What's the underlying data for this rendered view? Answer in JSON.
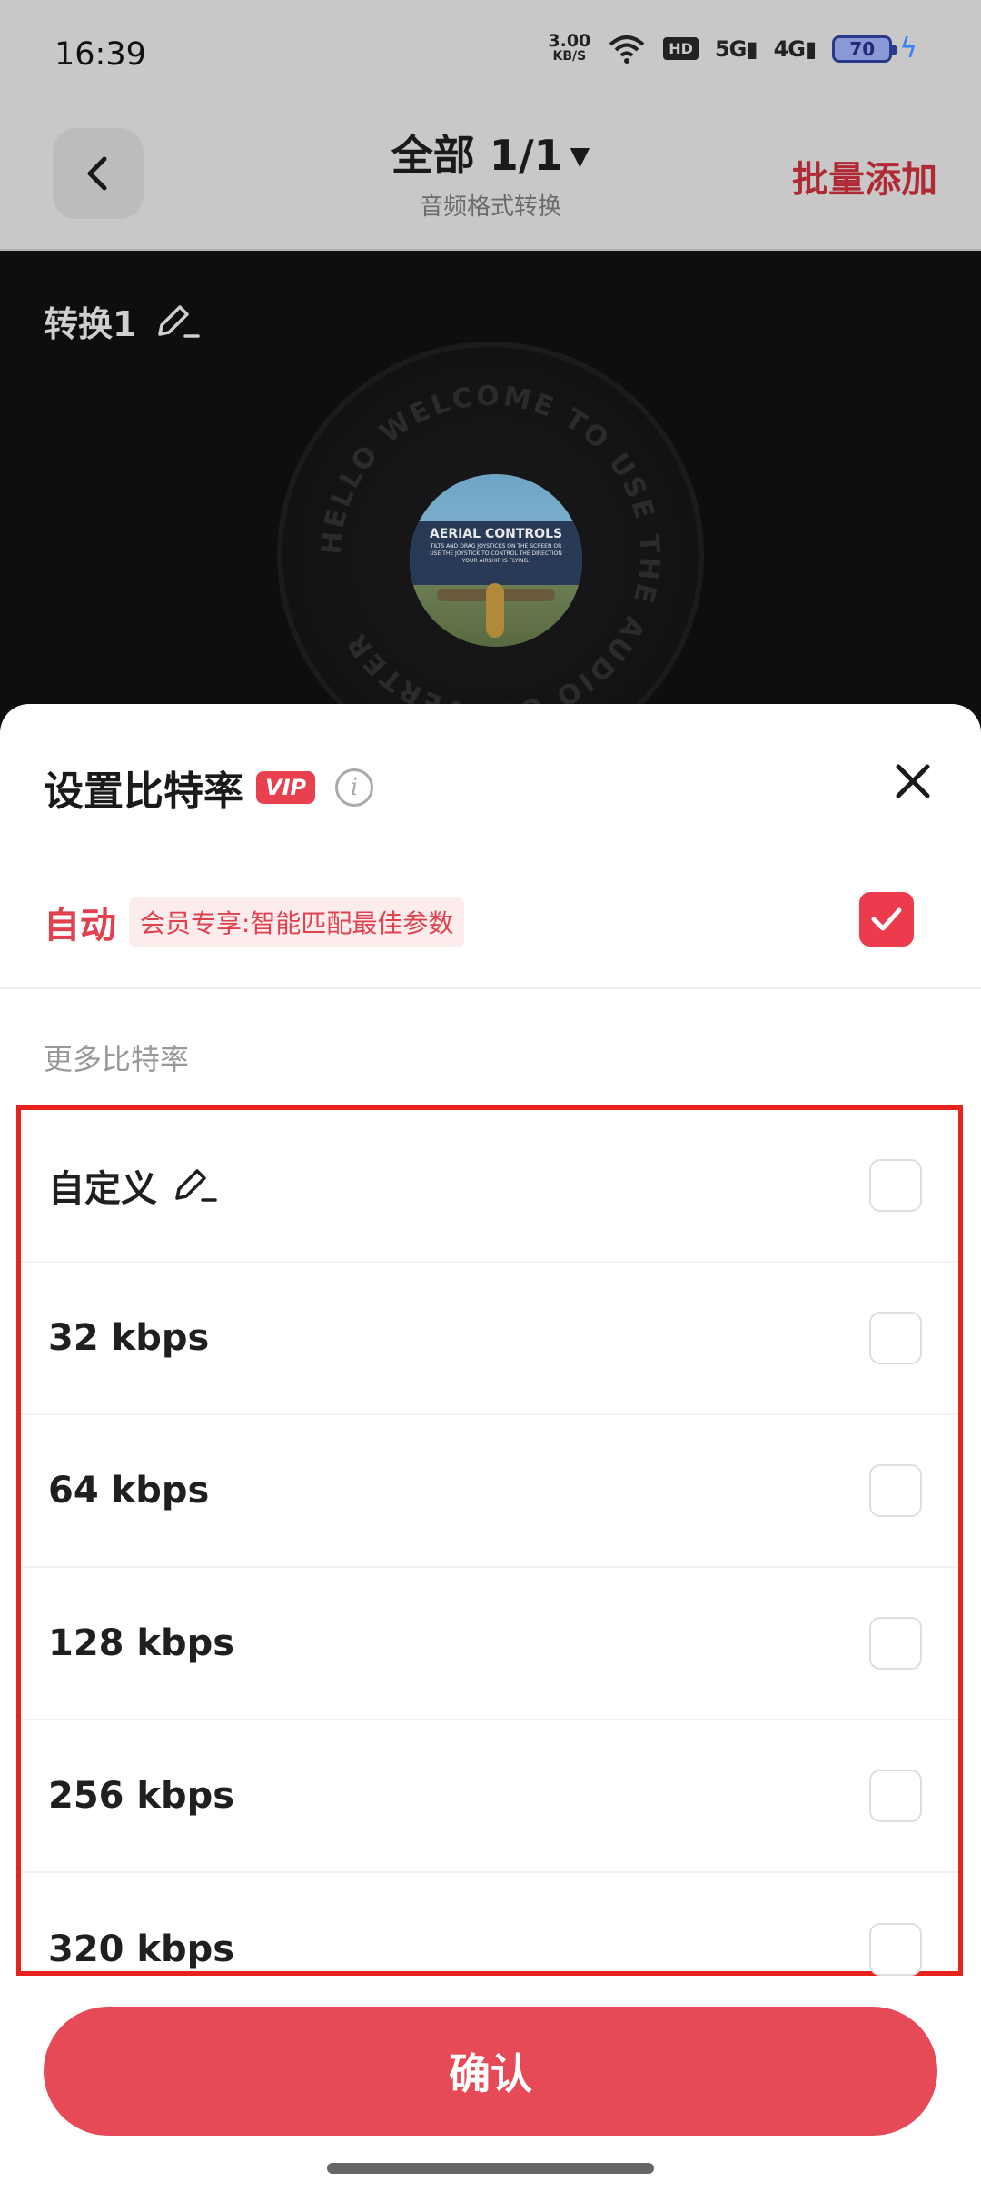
{
  "status_bar": {
    "time": "16:39",
    "net_speed_value": "3.00",
    "net_speed_unit": "KB/S",
    "hd_label": "HD",
    "signal_5g": "5G",
    "signal_4g": "4G",
    "battery": "70"
  },
  "header": {
    "title": "全部 1/1",
    "subtitle": "音频格式转换",
    "batch_add_label": "批量添加"
  },
  "player": {
    "track_name": "转换1",
    "disc_ring_text": "HELLO WELCOME TO USE THE AUDIO CONVERTER",
    "cover_title": "AERIAL CONTROLS",
    "cover_body": "TILTS AND DRAG JOYSTICKS ON THE SCREEN OR USE THE JOYSTICK TO CONTROL THE DIRECTION YOUR AIRSHIP IS FLYING."
  },
  "sheet": {
    "title": "设置比特率",
    "vip_badge": "VIP",
    "info_icon_glyph": "i",
    "auto_label": "自动",
    "auto_tag": "会员专享:智能匹配最佳参数",
    "auto_checked": true,
    "more_label": "更多比特率",
    "options": [
      {
        "label": "自定义",
        "editable": true,
        "checked": false
      },
      {
        "label": "32 kbps",
        "checked": false
      },
      {
        "label": "64 kbps",
        "checked": false
      },
      {
        "label": "128 kbps",
        "checked": false
      },
      {
        "label": "256 kbps",
        "checked": false
      },
      {
        "label": "320 kbps",
        "checked": false
      }
    ],
    "confirm_label": "确认"
  },
  "colors": {
    "accent": "#e64a57",
    "vip": "#e8404e",
    "highlight_border": "#e8221d"
  }
}
